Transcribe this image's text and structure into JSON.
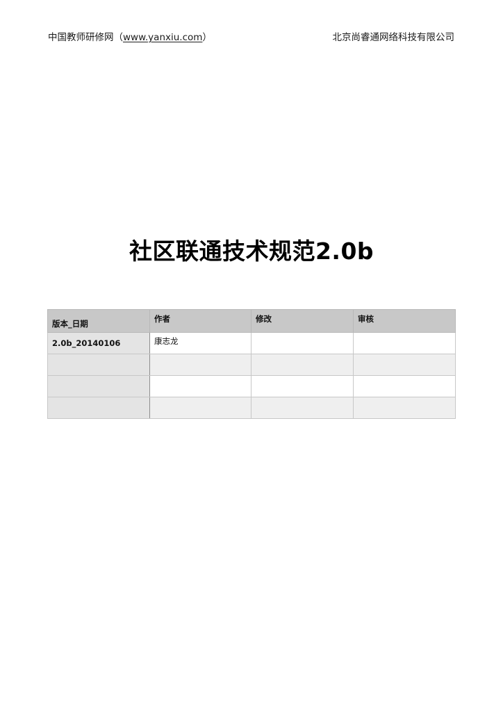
{
  "header": {
    "org_prefix": "中国教师研修网（",
    "org_url": "www.yanxiu.com",
    "org_suffix": "）",
    "company": "北京尚睿通网络科技有限公司"
  },
  "document": {
    "title": "社区联通技术规范2.0b"
  },
  "version_table": {
    "columns": [
      "版本_日期",
      "作者",
      "修改",
      "审核"
    ],
    "rows": [
      [
        "2.0b_20140106",
        "康志龙",
        "",
        ""
      ],
      [
        "",
        "",
        "",
        ""
      ],
      [
        "",
        "",
        "",
        ""
      ],
      [
        "",
        "",
        "",
        ""
      ]
    ]
  }
}
